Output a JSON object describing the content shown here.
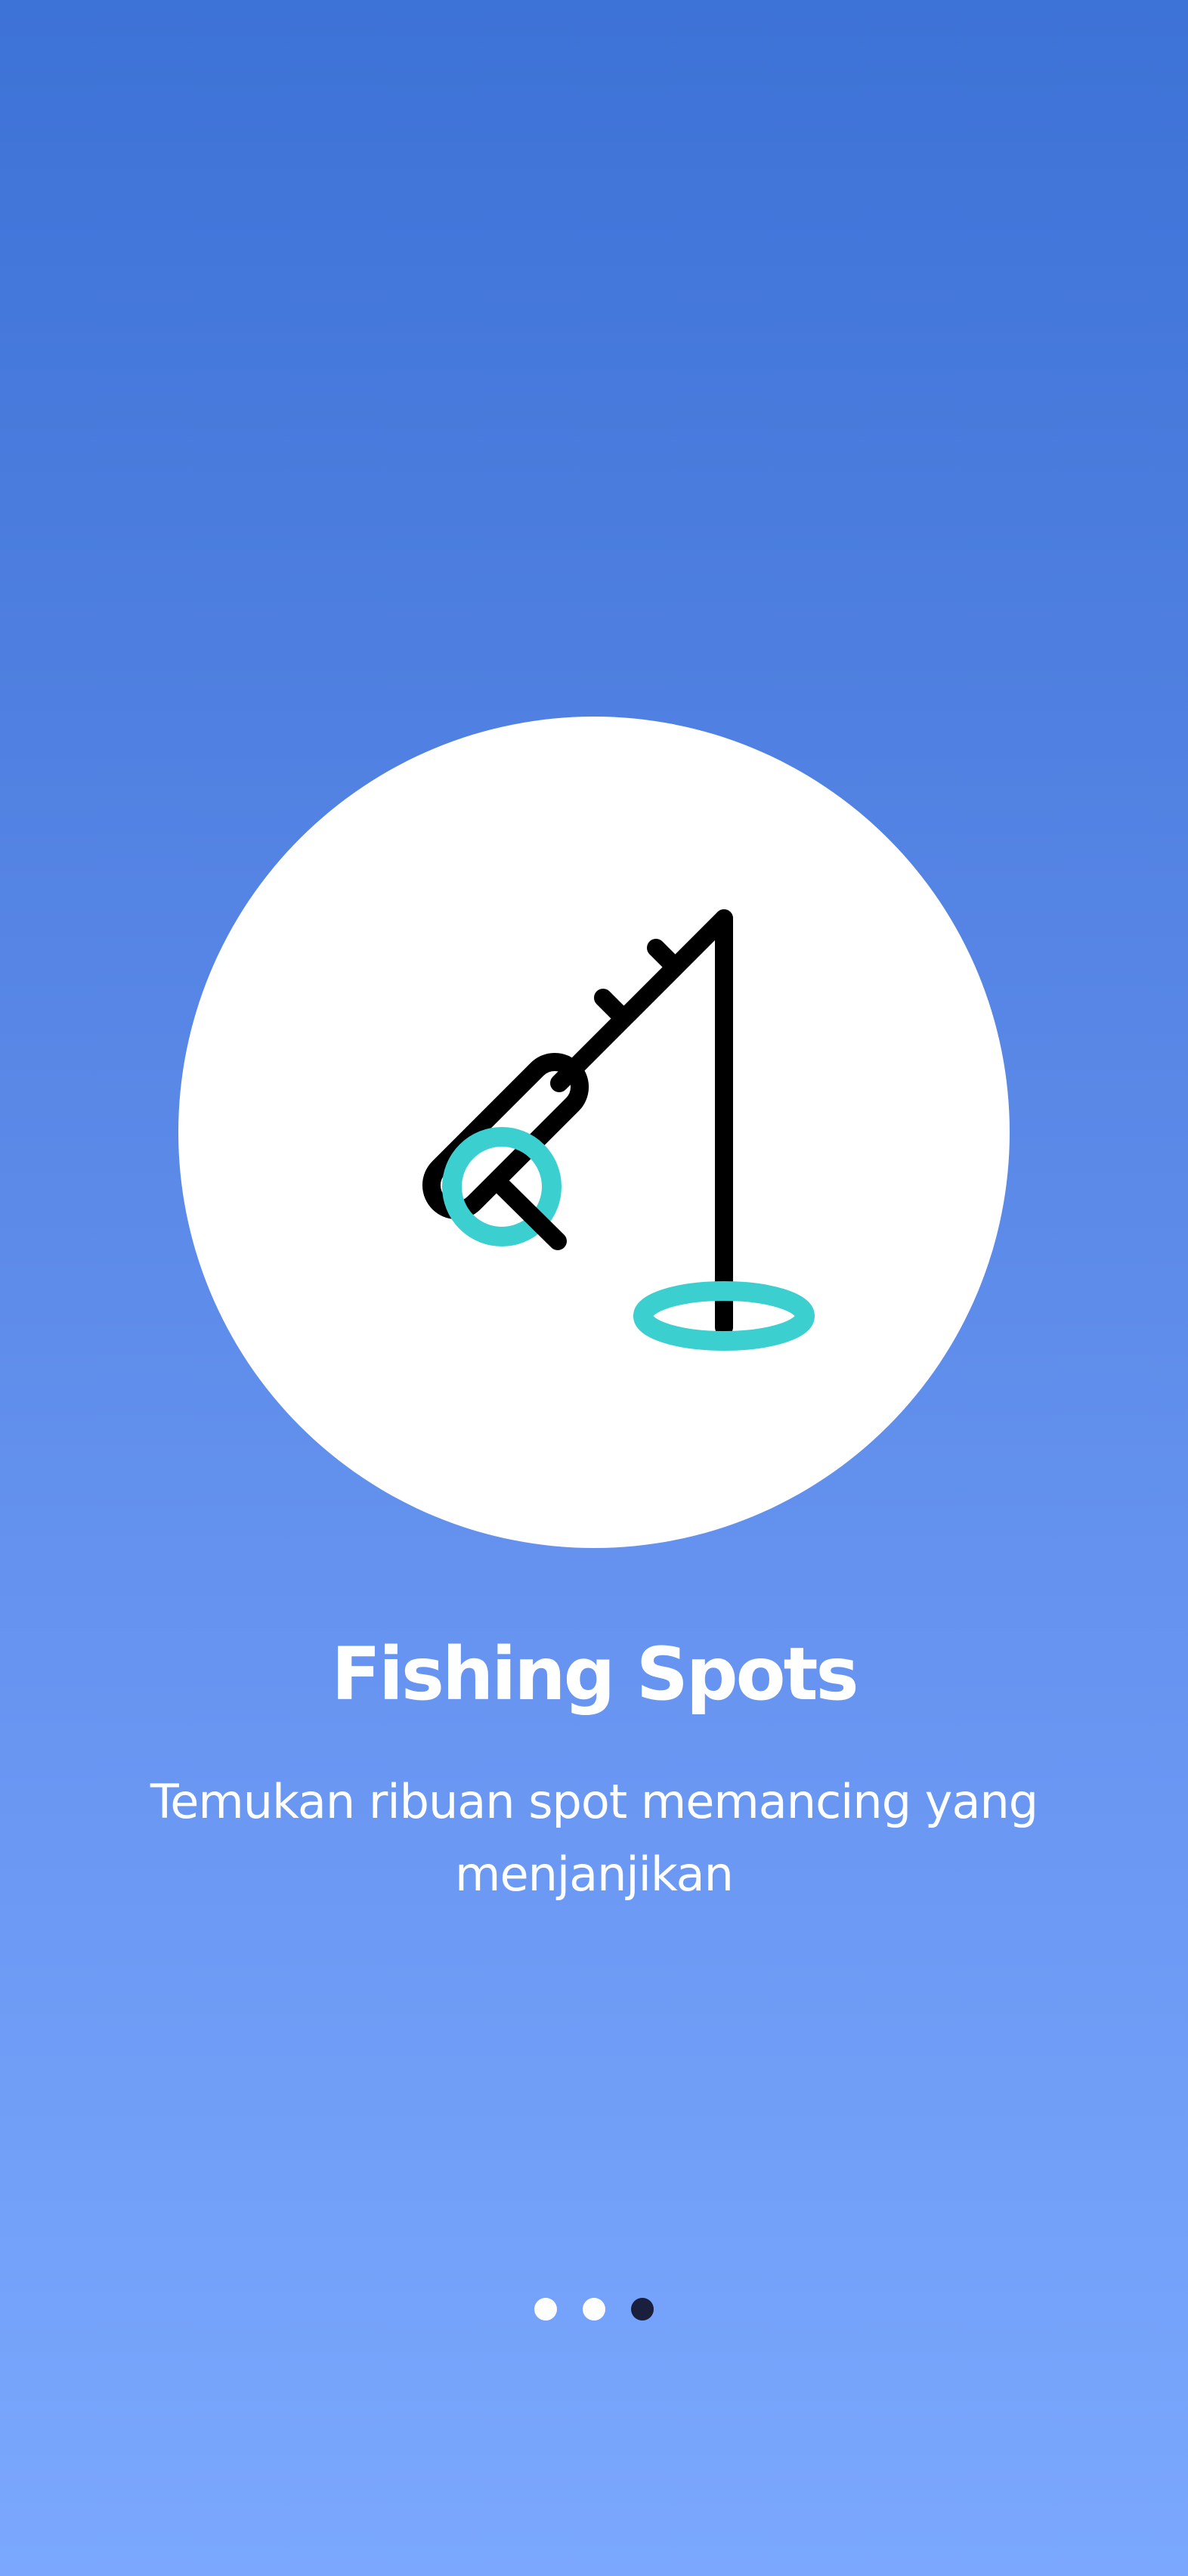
{
  "onboarding": {
    "title": "Fishing Spots",
    "description": "Temukan ribuan spot memancing yang menjanjikan",
    "illustration_icon": "fishing-rod-icon",
    "page_indicator": {
      "total": 3,
      "active_index": 2
    }
  },
  "colors": {
    "background_top": "#3d72d6",
    "background_bottom": "#7ba8fe",
    "accent_teal": "#3ccfcf",
    "icon_stroke": "#000000",
    "dot_inactive": "#ffffff",
    "dot_active": "#1a1f3d"
  }
}
